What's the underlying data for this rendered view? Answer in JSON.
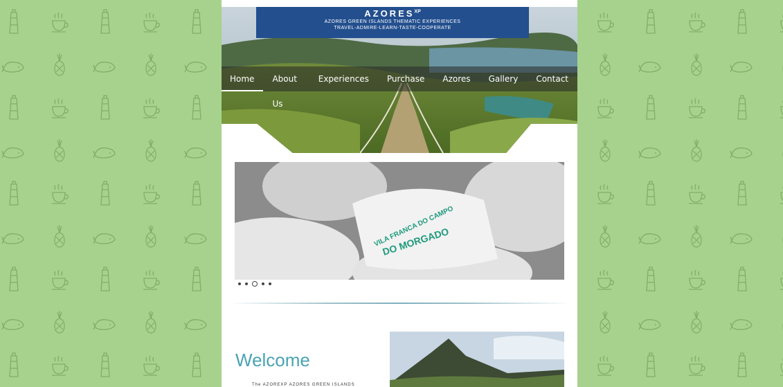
{
  "brand": {
    "name": "AZORES",
    "superscript": "XP",
    "tagline1": "AZORES GREEN ISLANDS THEMATIC EXPERIENCES",
    "tagline2": "TRAVEL-ADMIRE-LEARN-TASTE-COOPERATE"
  },
  "nav": {
    "items": [
      {
        "label": "Home"
      },
      {
        "label": "About Us"
      },
      {
        "label": "Experiences"
      },
      {
        "label": "Purchase"
      },
      {
        "label": "Azores"
      },
      {
        "label": "Gallery"
      },
      {
        "label": "Contact"
      }
    ]
  },
  "slider": {
    "label_top": "VILA FRANCA DO CAMPO",
    "label_bottom": "DO MORGADO",
    "active_dot": 3,
    "dot_count": 5
  },
  "welcome": {
    "title": "Welcome",
    "intro": "The AZOREXP AZORES GREEN ISLANDS"
  },
  "colors": {
    "background": "#a6d28d",
    "brand": "#234f8e",
    "welcome": "#4aa3b3"
  }
}
